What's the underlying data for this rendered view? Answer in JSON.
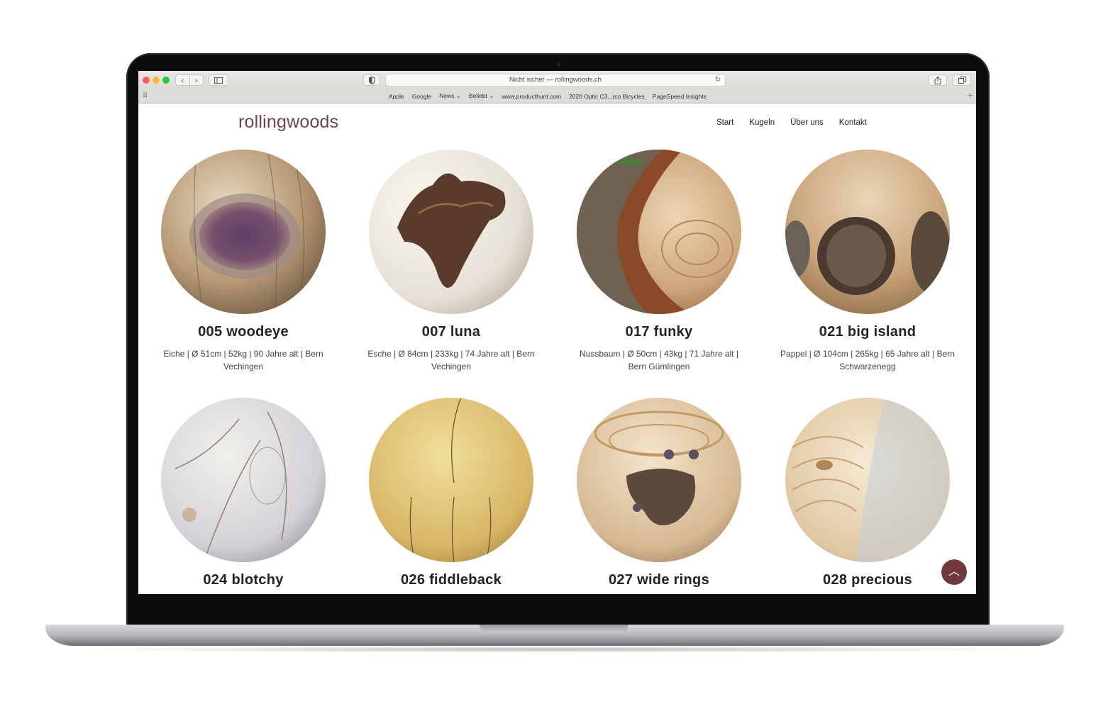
{
  "browser": {
    "address": "Nicht sicher — rollingwoods.ch",
    "favorites": [
      "Apple",
      "Google",
      "News ⌄",
      "Beliebt ⌄",
      "www.producthunt.com",
      "2020 Optic C3...rco Bicycles",
      "PageSpeed Insights"
    ]
  },
  "site": {
    "logo": "rollingwoods",
    "nav": [
      "Start",
      "Kugeln",
      "Über uns",
      "Kontakt"
    ],
    "products": [
      {
        "title": "005 woodeye",
        "desc": "Eiche | Ø 51cm | 52kg | 90 Jahre alt | Bern Vechingen"
      },
      {
        "title": "007 luna",
        "desc": "Esche | Ø 84cm | 233kg | 74 Jahre alt | Bern Vechingen"
      },
      {
        "title": "017 funky",
        "desc": "Nussbaum | Ø 50cm | 43kg | 71 Jahre alt | Bern Gümlingen"
      },
      {
        "title": "021 big island",
        "desc": "Pappel | Ø 104cm | 265kg | 65 Jahre alt | Bern Schwarzenegg"
      },
      {
        "title": "024 blotchy",
        "desc": ""
      },
      {
        "title": "026 fiddleback",
        "desc": ""
      },
      {
        "title": "027 wide rings",
        "desc": ""
      },
      {
        "title": "028 precious",
        "desc": ""
      }
    ]
  },
  "colors": {
    "brand": "#6e4546",
    "button": "#703a3c"
  },
  "icons": {
    "back": "chevron-left-icon",
    "forward": "chevron-right-icon",
    "scroll_top": "chevron-up-icon"
  }
}
